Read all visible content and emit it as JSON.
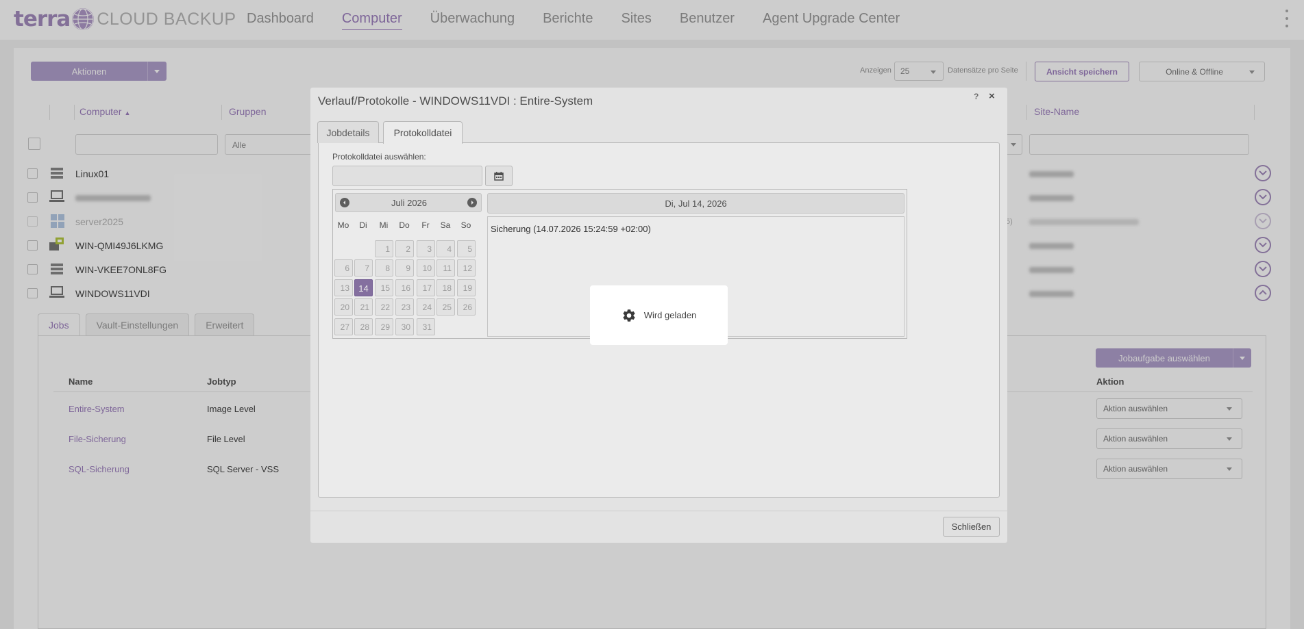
{
  "brand": {
    "word": "terra",
    "product": "CLOUD BACKUP",
    "accent_color": "#9d7fbe"
  },
  "nav": {
    "items": [
      "Dashboard",
      "Computer",
      "Überwachung",
      "Berichte",
      "Sites",
      "Benutzer",
      "Agent Upgrade Center"
    ],
    "active": "Computer"
  },
  "toolbar": {
    "actions_label": "Aktionen",
    "show_label": "Anzeigen",
    "page_size": "25",
    "per_page_label": "Datensätze pro Seite",
    "save_view_label": "Ansicht speichern",
    "status_filter": "Online & Offline"
  },
  "table": {
    "columns": [
      "Computer",
      "Gruppen",
      "Site-Name"
    ],
    "group_filter": "Alle",
    "rows": [
      {
        "name": "Linux01",
        "icon": "server-icon"
      },
      {
        "name": "",
        "icon": "laptop-icon"
      },
      {
        "name": "server2025",
        "icon": "windows-icon"
      },
      {
        "name": "WIN-QMI49J6LKMG",
        "icon": "hyperv-host-icon"
      },
      {
        "name": "WIN-VKEE7ONL8FG",
        "icon": "server-icon"
      },
      {
        "name": "WINDOWS11VDI",
        "icon": "laptop-icon"
      }
    ],
    "row3_site_suffix": "5)"
  },
  "details": {
    "tabs": [
      "Jobs",
      "Vault-Einstellungen",
      "Erweitert"
    ],
    "select_job_task_label": "Jobaufgabe auswählen",
    "headers": {
      "name": "Name",
      "type": "Jobtyp",
      "action": "Aktion"
    },
    "jobs": [
      {
        "name": "Entire-System",
        "type": "Image Level",
        "action": "Aktion auswählen"
      },
      {
        "name": "File-Sicherung",
        "type": "File Level",
        "action": "Aktion auswählen"
      },
      {
        "name": "SQL-Sicherung",
        "type": "SQL Server - VSS",
        "action": "Aktion auswählen"
      }
    ]
  },
  "modal": {
    "title": "Verlauf/Protokolle - WINDOWS11VDI : Entire-System",
    "help": "?",
    "close_symbol": "×",
    "tabs": [
      "Jobdetails",
      "Protokolldatei"
    ],
    "active_tab": "Protokolldatei",
    "select_label": "Protokolldatei auswählen:",
    "calendar": {
      "month_label": "Juli 2026",
      "weekdays": [
        "Mo",
        "Di",
        "Mi",
        "Do",
        "Fr",
        "Sa",
        "So"
      ],
      "weeks": [
        [
          "",
          "",
          "1",
          "2",
          "3",
          "4",
          "5"
        ],
        [
          "6",
          "7",
          "8",
          "9",
          "10",
          "11",
          "12"
        ],
        [
          "13",
          "14",
          "15",
          "16",
          "17",
          "18",
          "19"
        ],
        [
          "20",
          "21",
          "22",
          "23",
          "24",
          "25",
          "26"
        ],
        [
          "27",
          "28",
          "29",
          "30",
          "31",
          "",
          ""
        ]
      ],
      "selected_day": "14"
    },
    "date_heading": "Di, Jul 14, 2026",
    "entries": [
      "Sicherung (14.07.2026 15:24:59 +02:00)"
    ],
    "close_button": "Schließen"
  },
  "loading": {
    "text": "Wird geladen"
  }
}
